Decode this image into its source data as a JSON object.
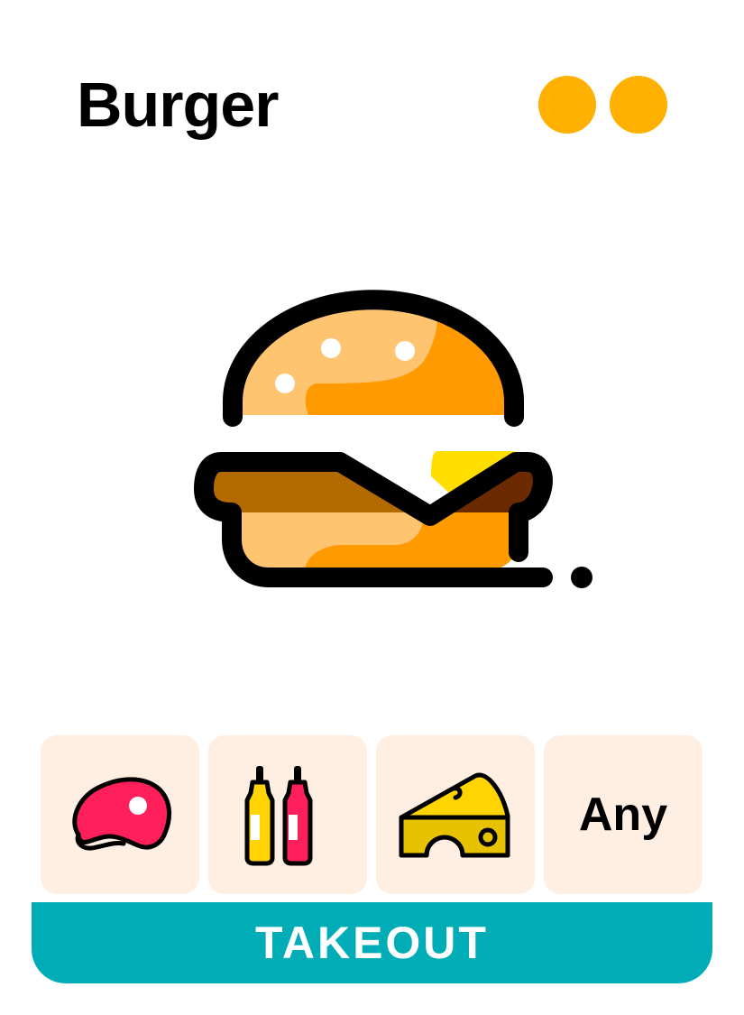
{
  "header": {
    "title": "Burger"
  },
  "indicator": {
    "dots": [
      "#FFB000",
      "#FFB000"
    ]
  },
  "hero": {
    "icon": "burger-icon"
  },
  "options": [
    {
      "icon": "meat-steak-icon",
      "label": ""
    },
    {
      "icon": "condiment-bottles-icon",
      "label": ""
    },
    {
      "icon": "cheese-wedge-icon",
      "label": ""
    },
    {
      "icon": "",
      "label": "Any"
    }
  ],
  "action": {
    "label": "TAKEOUT"
  },
  "colors": {
    "accent_dot": "#FFB000",
    "tile_bg": "#FFEEE2",
    "bar_bg": "#00ADB7",
    "text": "#000000"
  }
}
